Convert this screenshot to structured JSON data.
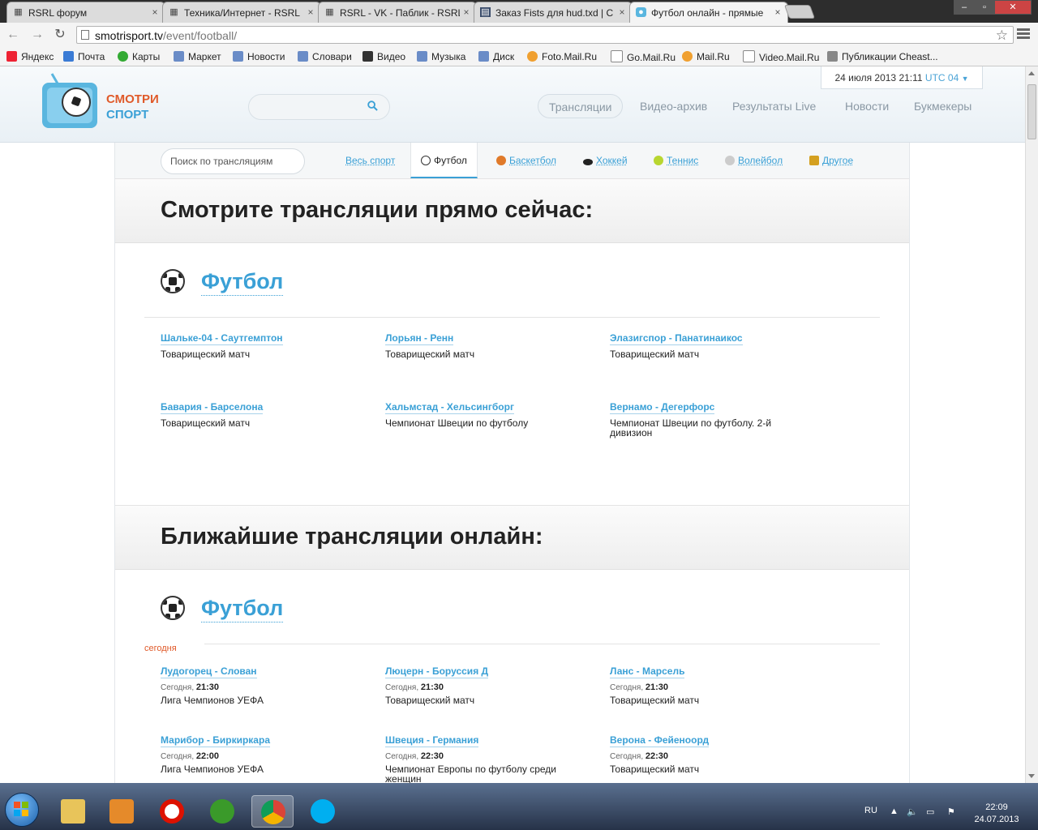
{
  "browser": {
    "tabs": [
      {
        "title": "RSRL форум"
      },
      {
        "title": "Техника/Интернет - RSRL"
      },
      {
        "title": "RSRL - VK - Паблик - RSRL"
      },
      {
        "title": "Заказ Fists для hud.txd | C"
      },
      {
        "title": "Футбол онлайн - прямые"
      }
    ],
    "url_host": "smotrisport.tv",
    "url_path": "/event/football/",
    "bookmarks": [
      "Яндекс",
      "Почта",
      "Карты",
      "Маркет",
      "Новости",
      "Словари",
      "Видео",
      "Музыка",
      "Диск",
      "Foto.Mail.Ru",
      "Go.Mail.Ru",
      "Mail.Ru",
      "Video.Mail.Ru",
      "Публикации Cheast..."
    ]
  },
  "header": {
    "logo_line1": "СМОТРИ",
    "logo_line2": "СПОРТ",
    "datetime": "24 июля 2013 21:11",
    "timezone": "UTC 04",
    "nav": [
      "Трансляции",
      "Видео-архив",
      "Результаты Live",
      "Новости",
      "Букмекеры"
    ]
  },
  "subnav": {
    "search_placeholder": "Поиск по трансляциям",
    "sports": [
      "Весь спорт",
      "Футбол",
      "Баскетбол",
      "Хоккей",
      "Теннис",
      "Волейбол",
      "Другое"
    ]
  },
  "live": {
    "heading": "Смотрите трансляции прямо сейчас:",
    "sport_name": "Футбол",
    "matches": [
      {
        "teams": "Шальке-04 - Саутгемптон",
        "tournament": "Товарищеский матч"
      },
      {
        "teams": "Лорьян - Ренн",
        "tournament": "Товарищеский матч"
      },
      {
        "teams": "Элазигспор - Панатинаикос",
        "tournament": "Товарищеский матч"
      },
      {
        "teams": "Бавария - Барселона",
        "tournament": "Товарищеский матч"
      },
      {
        "teams": "Хальмстад - Хельсингборг",
        "tournament": "Чемпионат Швеции по футболу"
      },
      {
        "teams": "Вернамо - Дегерфорс",
        "tournament": "Чемпионат Швеции по футболу. 2-й дивизион"
      }
    ]
  },
  "upcoming": {
    "heading": "Ближайшие трансляции онлайн:",
    "sport_name": "Футбол",
    "day_label": "сегодня",
    "matches": [
      {
        "teams": "Лудогорец - Слован",
        "day": "Сегодня,",
        "time": "21:30",
        "tournament": "Лига Чемпионов УЕФА"
      },
      {
        "teams": "Люцерн - Боруссия Д",
        "day": "Сегодня,",
        "time": "21:30",
        "tournament": "Товарищеский матч"
      },
      {
        "teams": "Ланс - Марсель",
        "day": "Сегодня,",
        "time": "21:30",
        "tournament": "Товарищеский матч"
      },
      {
        "teams": "Марибор - Биркиркара",
        "day": "Сегодня,",
        "time": "22:00",
        "tournament": "Лига Чемпионов УЕФА"
      },
      {
        "teams": "Швеция - Германия",
        "day": "Сегодня,",
        "time": "22:30",
        "tournament": "Чемпионат Европы по футболу среди женщин"
      },
      {
        "teams": "Верона - Фейеноорд",
        "day": "Сегодня,",
        "time": "22:30",
        "tournament": "Товарищеский матч"
      }
    ]
  },
  "taskbar": {
    "lang": "RU",
    "time": "22:09",
    "date": "24.07.2013"
  }
}
